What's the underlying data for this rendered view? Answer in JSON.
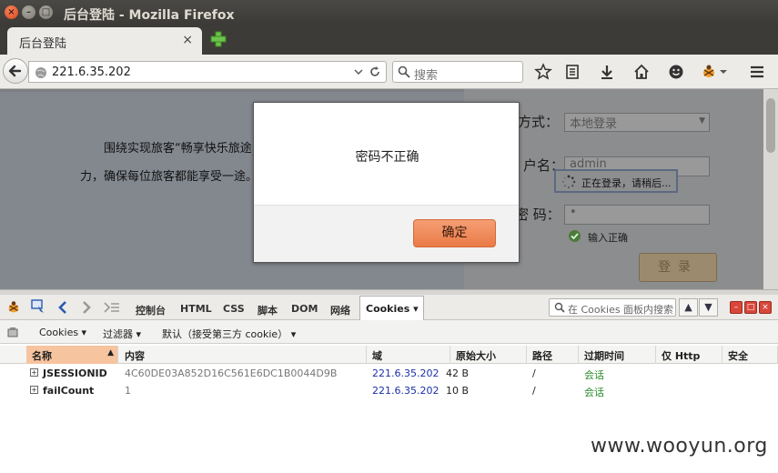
{
  "window": {
    "title": "后台登陆 - Mozilla Firefox"
  },
  "tab": {
    "label": "后台登陆",
    "close": "×"
  },
  "nav": {
    "url": "221.6.35.202",
    "search_placeholder": "搜索"
  },
  "page": {
    "intro_text": "围绕实现旅客“畅享快乐旅途”努力，确保每位旅客都能享受一途。",
    "form": {
      "login_method_label": "方式：",
      "login_method_value": "本地登录",
      "username_label": "户名：",
      "username_value": "admin",
      "password_label": "密  码：",
      "password_value": "•",
      "loading_text": "正在登录，请稍后...",
      "valid_hint": "输入正确",
      "submit_label": "登录"
    }
  },
  "modal": {
    "message": "密码不正确",
    "ok_label": "确定"
  },
  "devtools": {
    "tabs": [
      "控制台",
      "HTML",
      "CSS",
      "脚本",
      "DOM",
      "网络"
    ],
    "active_tab": "Cookies ▾",
    "search_placeholder": "在 Cookies 面板内搜索",
    "subbar": {
      "cookies_menu": "Cookies ▾",
      "filter_menu": "过滤器 ▾",
      "default_menu": "默认（接受第三方 cookie） ▾"
    },
    "columns": {
      "name": "名称",
      "content": "内容",
      "domain": "域",
      "raw_size": "原始大小",
      "path": "路径",
      "expires": "过期时间",
      "http_only": "仅 Http",
      "secure": "安全"
    },
    "rows": [
      {
        "name": "JSESSIONID",
        "content": "4C60DE03A852D16C561E6DC1B0044D9B",
        "domain": "221.6.35.202",
        "size": "42 B",
        "path": "/",
        "expires": "会话"
      },
      {
        "name": "failCount",
        "content": "1",
        "domain": "221.6.35.202",
        "size": "10 B",
        "path": "/",
        "expires": "会话"
      }
    ]
  },
  "watermark": "www.wooyun.org",
  "colors": {
    "modal_ok": "#ea7b47",
    "domain_link": "#1c2fa8",
    "expires_green": "#2a8a2a",
    "sort_header": "#f6c49f"
  }
}
